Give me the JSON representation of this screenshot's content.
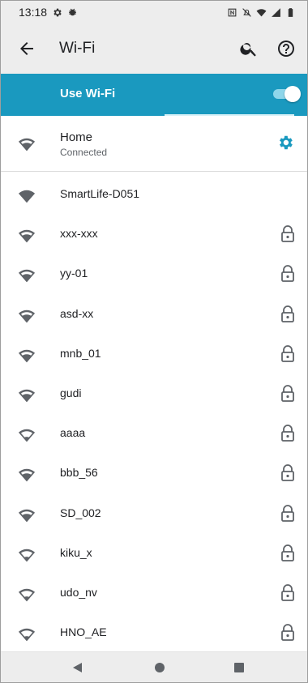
{
  "status_bar": {
    "time": "13:18",
    "left_icons": [
      "gear-icon",
      "bug-icon"
    ],
    "right_icons": [
      "nfc-icon",
      "mute-icon",
      "wifi-icon",
      "signal-icon",
      "battery-icon"
    ]
  },
  "app_bar": {
    "title": "Wi-Fi",
    "back_icon": "arrow-back-icon",
    "search_icon": "search-icon",
    "help_icon": "help-icon"
  },
  "wifi_toggle": {
    "label": "Use Wi-Fi",
    "enabled": true,
    "accent_color": "#1a99bf"
  },
  "connected_network": {
    "name": "Home",
    "status": "Connected",
    "settings_icon": "gear-icon",
    "settings_color": "#1a99bf"
  },
  "networks": [
    {
      "name": "SmartLife-D051",
      "secured": false,
      "signal": "full"
    },
    {
      "name": "xxx-xxx",
      "secured": true,
      "signal": "medium"
    },
    {
      "name": "yy-01",
      "secured": true,
      "signal": "medium"
    },
    {
      "name": "asd-xx",
      "secured": true,
      "signal": "medium"
    },
    {
      "name": "mnb_01",
      "secured": true,
      "signal": "medium"
    },
    {
      "name": "gudi",
      "secured": true,
      "signal": "medium"
    },
    {
      "name": "aaaa",
      "secured": true,
      "signal": "low"
    },
    {
      "name": "bbb_56",
      "secured": true,
      "signal": "medium"
    },
    {
      "name": "SD_002",
      "secured": true,
      "signal": "medium"
    },
    {
      "name": "kiku_x",
      "secured": true,
      "signal": "low"
    },
    {
      "name": "udo_nv",
      "secured": true,
      "signal": "low"
    },
    {
      "name": "HNO_AE",
      "secured": true,
      "signal": "low"
    }
  ],
  "nav_bar": {
    "back": "triangle-back-icon",
    "home": "circle-home-icon",
    "recents": "square-recents-icon"
  }
}
